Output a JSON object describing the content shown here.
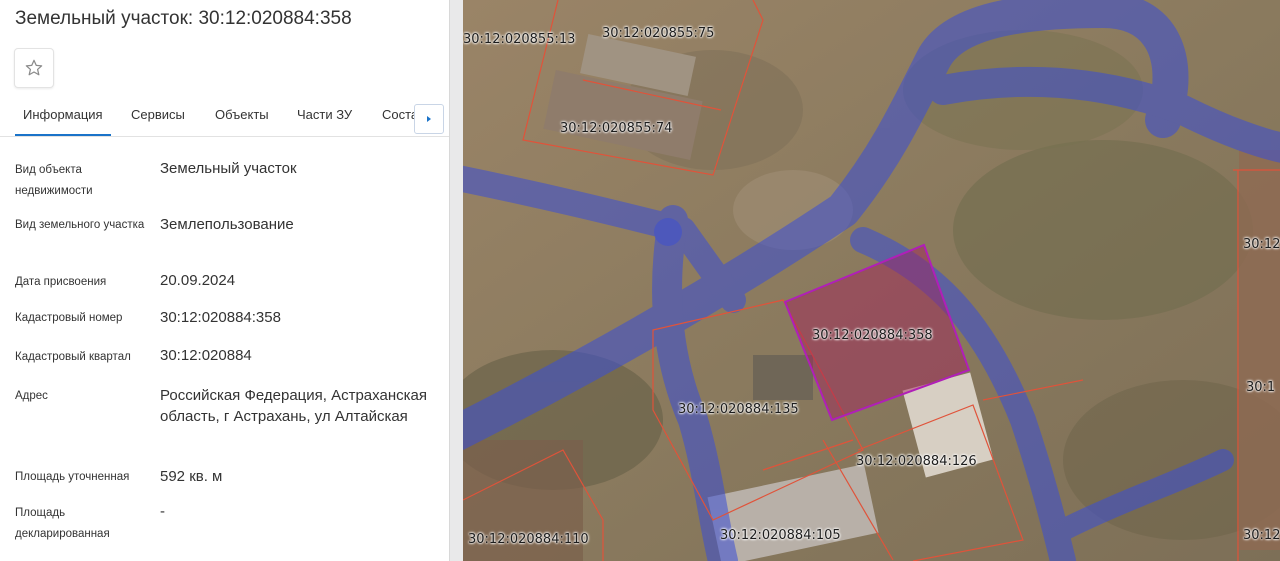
{
  "title": "Земельный участок: 30:12:020884:358",
  "tabs": [
    "Информация",
    "Сервисы",
    "Объекты",
    "Части ЗУ",
    "Соста"
  ],
  "icons": {
    "favorite": "star-icon",
    "scroll_tabs": "triangle-right-icon"
  },
  "info": {
    "object_type_label": "Вид объекта недвижимости",
    "object_type_value": "Земельный участок",
    "land_type_label": "Вид земельного участка",
    "land_type_value": "Землепользование",
    "date_label": "Дата присвоения",
    "date_value": "20.09.2024",
    "cad_number_label": "Кадастровый номер",
    "cad_number_value": "30:12:020884:358",
    "cad_quarter_label": "Кадастровый квартал",
    "cad_quarter_value": "30:12:020884",
    "address_label": "Адрес",
    "address_value": "Российская Федерация, Астраханская область, г Астрахань, ул Алтайская",
    "area_label": "Площадь уточненная",
    "area_value": "592 кв. м",
    "declared_area_label": "Площадь декларированная",
    "declared_area_value": "-"
  },
  "map_labels": [
    "30:12:020855:13",
    "30:12:020855:75",
    "30:12:020855:74",
    "30:12:020884:358",
    "30:12:020884:135",
    "30:12:020884:126",
    "30:12:020884:105",
    "30:12:020884:110",
    "30:12",
    "30:12",
    "30:1"
  ],
  "colors": {
    "accent": "#1a73c9",
    "parcel_border": "#e0533a",
    "selected_parcel": "#b01fb8",
    "zone_overlay": "#3a4ed6"
  }
}
